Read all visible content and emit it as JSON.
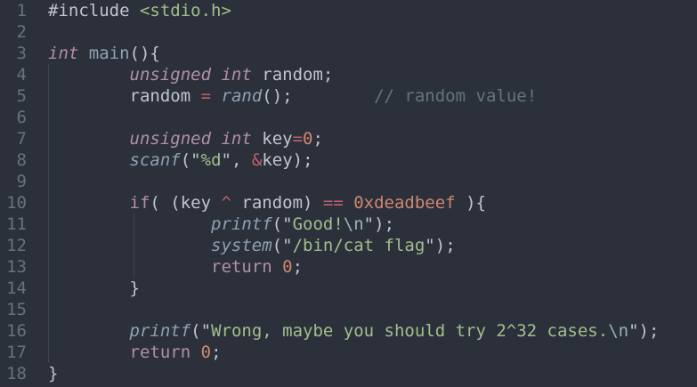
{
  "editor": {
    "language": "c",
    "theme_colors": {
      "background": "#2b303b",
      "foreground": "#c0c5ce",
      "line_number": "#65737e",
      "keyword": "#b48ead",
      "function": "#8fa1b3",
      "string": "#a3be8c",
      "number": "#d08770",
      "escape": "#96b5b4",
      "comment": "#65737e"
    },
    "line_numbers": [
      "1",
      "2",
      "3",
      "4",
      "5",
      "6",
      "7",
      "8",
      "9",
      "10",
      "11",
      "12",
      "13",
      "14",
      "15",
      "16",
      "17",
      "18"
    ],
    "lines": [
      [
        {
          "t": "#include ",
          "c": "plain"
        },
        {
          "t": "<stdio.h>",
          "c": "str"
        }
      ],
      [],
      [
        {
          "t": "int",
          "c": "kw-type"
        },
        {
          "t": " ",
          "c": "plain"
        },
        {
          "t": "main",
          "c": "fn-noital"
        },
        {
          "t": "(){",
          "c": "plain"
        }
      ],
      [
        {
          "t": "        ",
          "c": "plain"
        },
        {
          "t": "unsigned",
          "c": "kw-type"
        },
        {
          "t": " ",
          "c": "plain"
        },
        {
          "t": "int",
          "c": "kw-type"
        },
        {
          "t": " random;",
          "c": "plain"
        }
      ],
      [
        {
          "t": "        random ",
          "c": "plain"
        },
        {
          "t": "=",
          "c": "op-hl"
        },
        {
          "t": " ",
          "c": "plain"
        },
        {
          "t": "rand",
          "c": "fn"
        },
        {
          "t": "();",
          "c": "plain"
        },
        {
          "t": "        ",
          "c": "plain"
        },
        {
          "t": "// random value!",
          "c": "cm"
        }
      ],
      [],
      [
        {
          "t": "        ",
          "c": "plain"
        },
        {
          "t": "unsigned",
          "c": "kw-type"
        },
        {
          "t": " ",
          "c": "plain"
        },
        {
          "t": "int",
          "c": "kw-type"
        },
        {
          "t": " key",
          "c": "plain"
        },
        {
          "t": "=",
          "c": "op-hl"
        },
        {
          "t": "0",
          "c": "num"
        },
        {
          "t": ";",
          "c": "plain"
        }
      ],
      [
        {
          "t": "        ",
          "c": "plain"
        },
        {
          "t": "scanf",
          "c": "fn"
        },
        {
          "t": "(",
          "c": "plain"
        },
        {
          "t": "\"",
          "c": "plain"
        },
        {
          "t": "%d",
          "c": "str"
        },
        {
          "t": "\"",
          "c": "plain"
        },
        {
          "t": ", ",
          "c": "plain"
        },
        {
          "t": "&",
          "c": "op-hl"
        },
        {
          "t": "key);",
          "c": "plain"
        }
      ],
      [],
      [
        {
          "t": "        ",
          "c": "plain"
        },
        {
          "t": "if",
          "c": "kw"
        },
        {
          "t": "( (key ",
          "c": "plain"
        },
        {
          "t": "^",
          "c": "op-hl"
        },
        {
          "t": " random) ",
          "c": "plain"
        },
        {
          "t": "==",
          "c": "op-hl"
        },
        {
          "t": " ",
          "c": "plain"
        },
        {
          "t": "0xdeadbeef",
          "c": "num"
        },
        {
          "t": " ){",
          "c": "plain"
        }
      ],
      [
        {
          "t": "                ",
          "c": "plain"
        },
        {
          "t": "printf",
          "c": "fn"
        },
        {
          "t": "(",
          "c": "plain"
        },
        {
          "t": "\"",
          "c": "plain"
        },
        {
          "t": "Good!",
          "c": "str"
        },
        {
          "t": "\\n",
          "c": "esc"
        },
        {
          "t": "\"",
          "c": "plain"
        },
        {
          "t": ");",
          "c": "plain"
        }
      ],
      [
        {
          "t": "                ",
          "c": "plain"
        },
        {
          "t": "system",
          "c": "fn"
        },
        {
          "t": "(",
          "c": "plain"
        },
        {
          "t": "\"",
          "c": "plain"
        },
        {
          "t": "/bin/cat flag",
          "c": "str"
        },
        {
          "t": "\"",
          "c": "plain"
        },
        {
          "t": ");",
          "c": "plain"
        }
      ],
      [
        {
          "t": "                ",
          "c": "plain"
        },
        {
          "t": "return",
          "c": "kw"
        },
        {
          "t": " ",
          "c": "plain"
        },
        {
          "t": "0",
          "c": "num"
        },
        {
          "t": ";",
          "c": "plain"
        }
      ],
      [
        {
          "t": "        }",
          "c": "plain"
        }
      ],
      [],
      [
        {
          "t": "        ",
          "c": "plain"
        },
        {
          "t": "printf",
          "c": "fn"
        },
        {
          "t": "(",
          "c": "plain"
        },
        {
          "t": "\"",
          "c": "plain"
        },
        {
          "t": "Wrong, maybe you should try 2^32 cases.",
          "c": "str"
        },
        {
          "t": "\\n",
          "c": "esc"
        },
        {
          "t": "\"",
          "c": "plain"
        },
        {
          "t": ");",
          "c": "plain"
        }
      ],
      [
        {
          "t": "        ",
          "c": "plain"
        },
        {
          "t": "return",
          "c": "kw"
        },
        {
          "t": " ",
          "c": "plain"
        },
        {
          "t": "0",
          "c": "num"
        },
        {
          "t": ";",
          "c": "plain"
        }
      ],
      [
        {
          "t": "}",
          "c": "plain"
        }
      ]
    ]
  }
}
